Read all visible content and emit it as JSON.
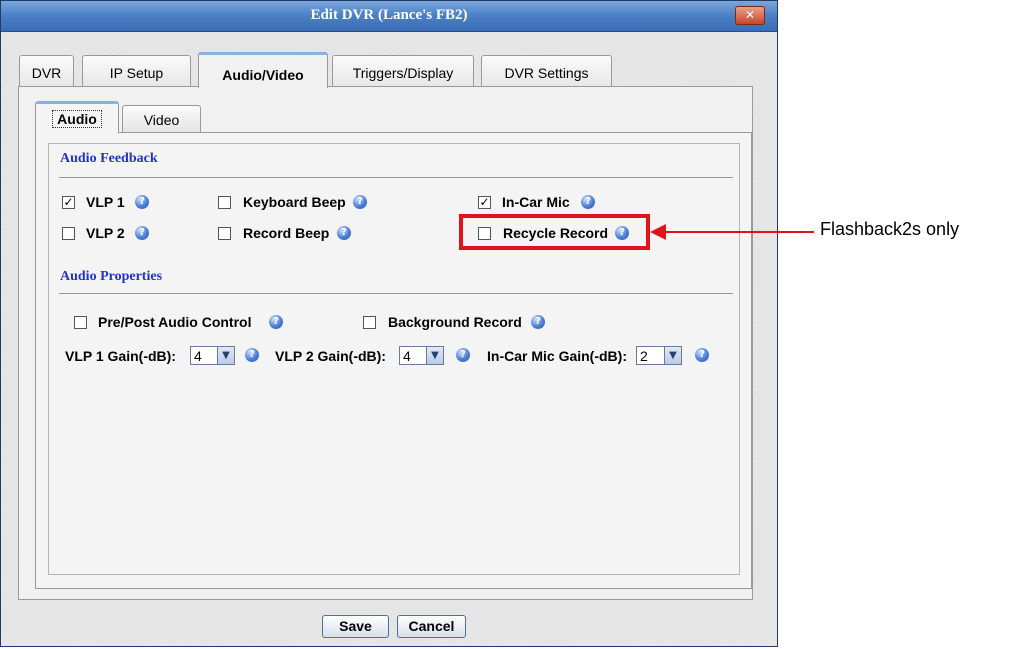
{
  "window": {
    "title": "Edit DVR (Lance's FB2)",
    "close_glyph": "✕"
  },
  "tabs": [
    {
      "label": "DVR"
    },
    {
      "label": "IP Setup"
    },
    {
      "label": "Audio/Video",
      "active": true
    },
    {
      "label": "Triggers/Display"
    },
    {
      "label": "DVR Settings"
    }
  ],
  "subtabs": [
    {
      "label": "Audio",
      "active": true
    },
    {
      "label": "Video"
    }
  ],
  "audio_feedback": {
    "title": "Audio Feedback",
    "items": [
      {
        "label": "VLP 1",
        "checked": true
      },
      {
        "label": "Keyboard Beep",
        "checked": false
      },
      {
        "label": "In-Car Mic",
        "checked": true
      },
      {
        "label": "VLP 2",
        "checked": false
      },
      {
        "label": "Record Beep",
        "checked": false
      },
      {
        "label": "Recycle Record",
        "checked": false
      }
    ]
  },
  "audio_properties": {
    "title": "Audio Properties",
    "pre_post_label": "Pre/Post Audio Control",
    "background_label": "Background Record",
    "gains": [
      {
        "label": "VLP 1 Gain(-dB):",
        "value": "4"
      },
      {
        "label": "VLP 2 Gain(-dB):",
        "value": "4"
      },
      {
        "label": "In-Car Mic Gain(-dB):",
        "value": "2"
      }
    ]
  },
  "buttons": {
    "save": "Save",
    "cancel": "Cancel"
  },
  "annotation": {
    "text": "Flashback2s only",
    "color": "#e0131a"
  },
  "glyphs": {
    "check": "✓",
    "help": "?",
    "dropdown": "▼"
  },
  "icons": {
    "help": "help-icon",
    "close": "close-icon",
    "dropdown": "chevron-down-icon"
  }
}
